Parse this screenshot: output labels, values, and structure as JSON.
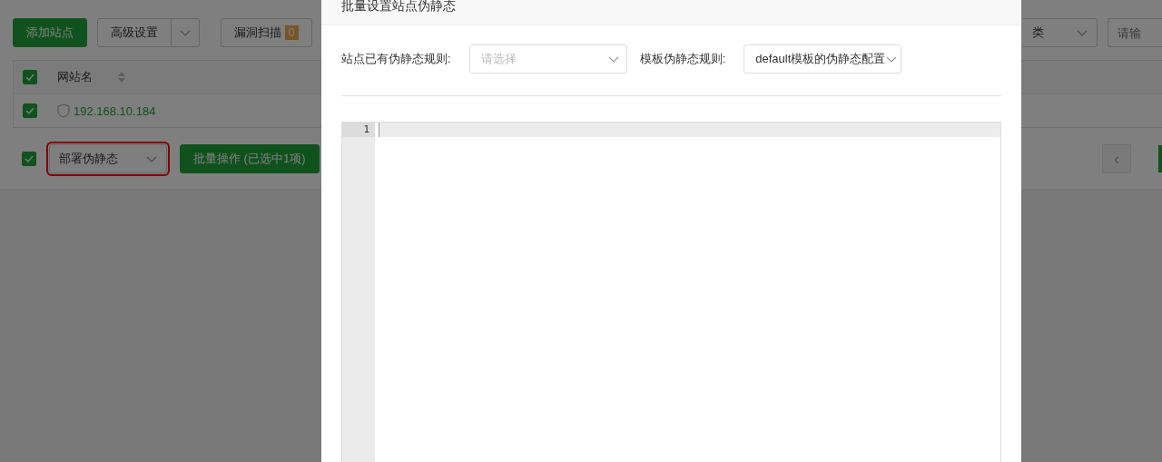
{
  "toolbar": {
    "add_button": "添加站点",
    "advanced_button": "高级设置",
    "scan_button": "漏洞扫描",
    "scan_count": "0",
    "category_select": "类",
    "search": {
      "placeholder": "请输"
    }
  },
  "table": {
    "header": {
      "checked": true,
      "column": "网站名"
    },
    "rows": [
      {
        "checked": true,
        "name": "192.168.10.184"
      }
    ]
  },
  "footer": {
    "checked": true,
    "action_select": "部署伪静态",
    "highlighted": true,
    "batch_button": "批量操作 (已选中1项)",
    "prev_button": "‹"
  },
  "dialog": {
    "title": "批量设置站点伪静态",
    "site_rule_label": "站点已有伪静态规则:",
    "site_rule_select": {
      "placeholder": "请选择"
    },
    "template_label": "模板伪静态规则:",
    "template_select": "default模板的伪静态配置",
    "editor": {
      "line_numbers": [
        "1"
      ]
    }
  }
}
